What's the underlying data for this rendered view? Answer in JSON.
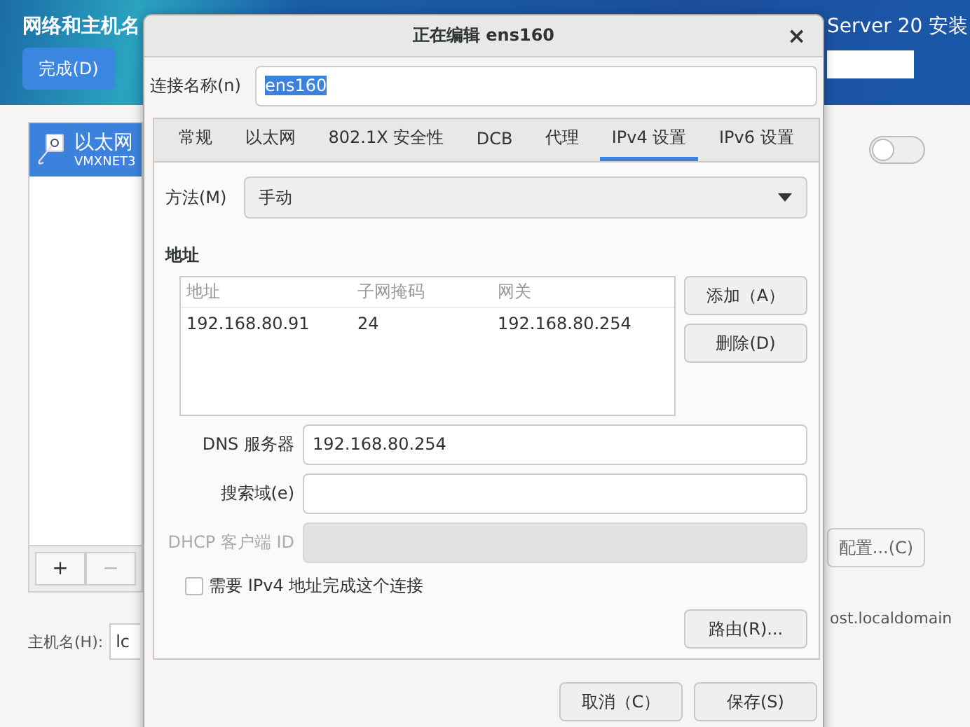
{
  "background": {
    "title": "网络和主机名",
    "done_button": "完成(D)",
    "product_title": "Server 20 安装",
    "connections": [
      {
        "name": "以太网",
        "device": "VMXNET3",
        "selected": true
      }
    ],
    "list_buttons": [
      {
        "label": "+",
        "disabled": false
      },
      {
        "label": "−",
        "disabled": true
      }
    ],
    "toggle": {
      "on": false
    },
    "configure_button": "配置...(C)",
    "hostname_label": "主机名(H):",
    "hostname_value": "lc",
    "current_hostname": "ost.localdomain"
  },
  "dialog": {
    "title": "正在编辑 ens160",
    "close": "×",
    "connection_name_label": "连接名称(n)",
    "connection_name": {
      "value": "ens160",
      "selected": true
    },
    "tabs": [
      {
        "label": "常规",
        "selected": false
      },
      {
        "label": "以太网",
        "selected": false
      },
      {
        "label": "802.1X 安全性",
        "selected": false
      },
      {
        "label": "DCB",
        "selected": false
      },
      {
        "label": "代理",
        "selected": false
      },
      {
        "label": "IPv4 设置",
        "selected": true
      },
      {
        "label": "IPv6 设置",
        "selected": false
      }
    ],
    "method_label": "方法(M)",
    "method": "手动",
    "addresses_heading": "地址",
    "table": {
      "columns": [
        "地址",
        "子网掩码",
        "网关"
      ],
      "rows": [
        [
          "192.168.80.91",
          "24",
          "192.168.80.254"
        ]
      ]
    },
    "add_button": "添加（A）",
    "delete_button": "删除(D)",
    "fields": [
      {
        "label": "DNS 服务器",
        "value": "192.168.80.254",
        "disabled": false
      },
      {
        "label": "搜索域(e)",
        "disabled": false
      },
      {
        "label": "DHCP 客户端 ID",
        "disabled": true
      }
    ],
    "require_ipv4": {
      "label": "需要 IPv4 地址完成这个连接",
      "checked": false
    },
    "routes_button": "路由(R)...",
    "buttons": [
      "取消（C）",
      "保存(S)"
    ]
  }
}
